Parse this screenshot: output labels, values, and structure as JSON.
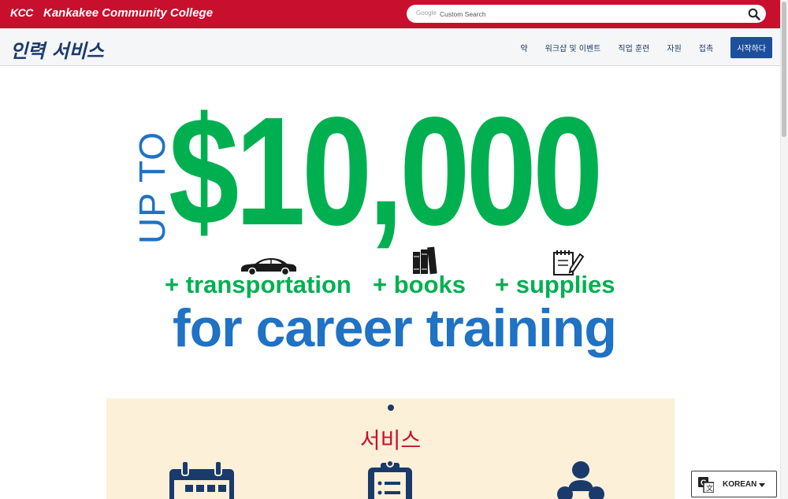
{
  "header": {
    "logo_text": "KCC",
    "college_name": "Kankakee Community College",
    "search": {
      "brand": "Google",
      "placeholder": "Custom Search"
    }
  },
  "nav": {
    "site_title": "인력 서비스",
    "items": [
      {
        "label": "약"
      },
      {
        "label": "워크샵 및 이벤트"
      },
      {
        "label": "직업 훈련"
      },
      {
        "label": "자원"
      },
      {
        "label": "접촉"
      }
    ],
    "cta": "시작하다"
  },
  "hero": {
    "prefix": "UP TO",
    "amount": "$10,000",
    "extras": [
      "+ transportation",
      "+ books",
      "+ supplies"
    ],
    "tagline": "for career training",
    "colors": {
      "green": "#00b050",
      "blue": "#1f72c4"
    }
  },
  "services": {
    "title": "서비스",
    "icons": [
      "calendar-icon",
      "clipboard-icon",
      "people-icon"
    ]
  },
  "language": {
    "label": "KOREAN"
  },
  "colors": {
    "brand_red": "#c8102e",
    "navy": "#1a3a6b",
    "cta_blue": "#1d4f9c",
    "services_bg": "#fdf0d8"
  }
}
